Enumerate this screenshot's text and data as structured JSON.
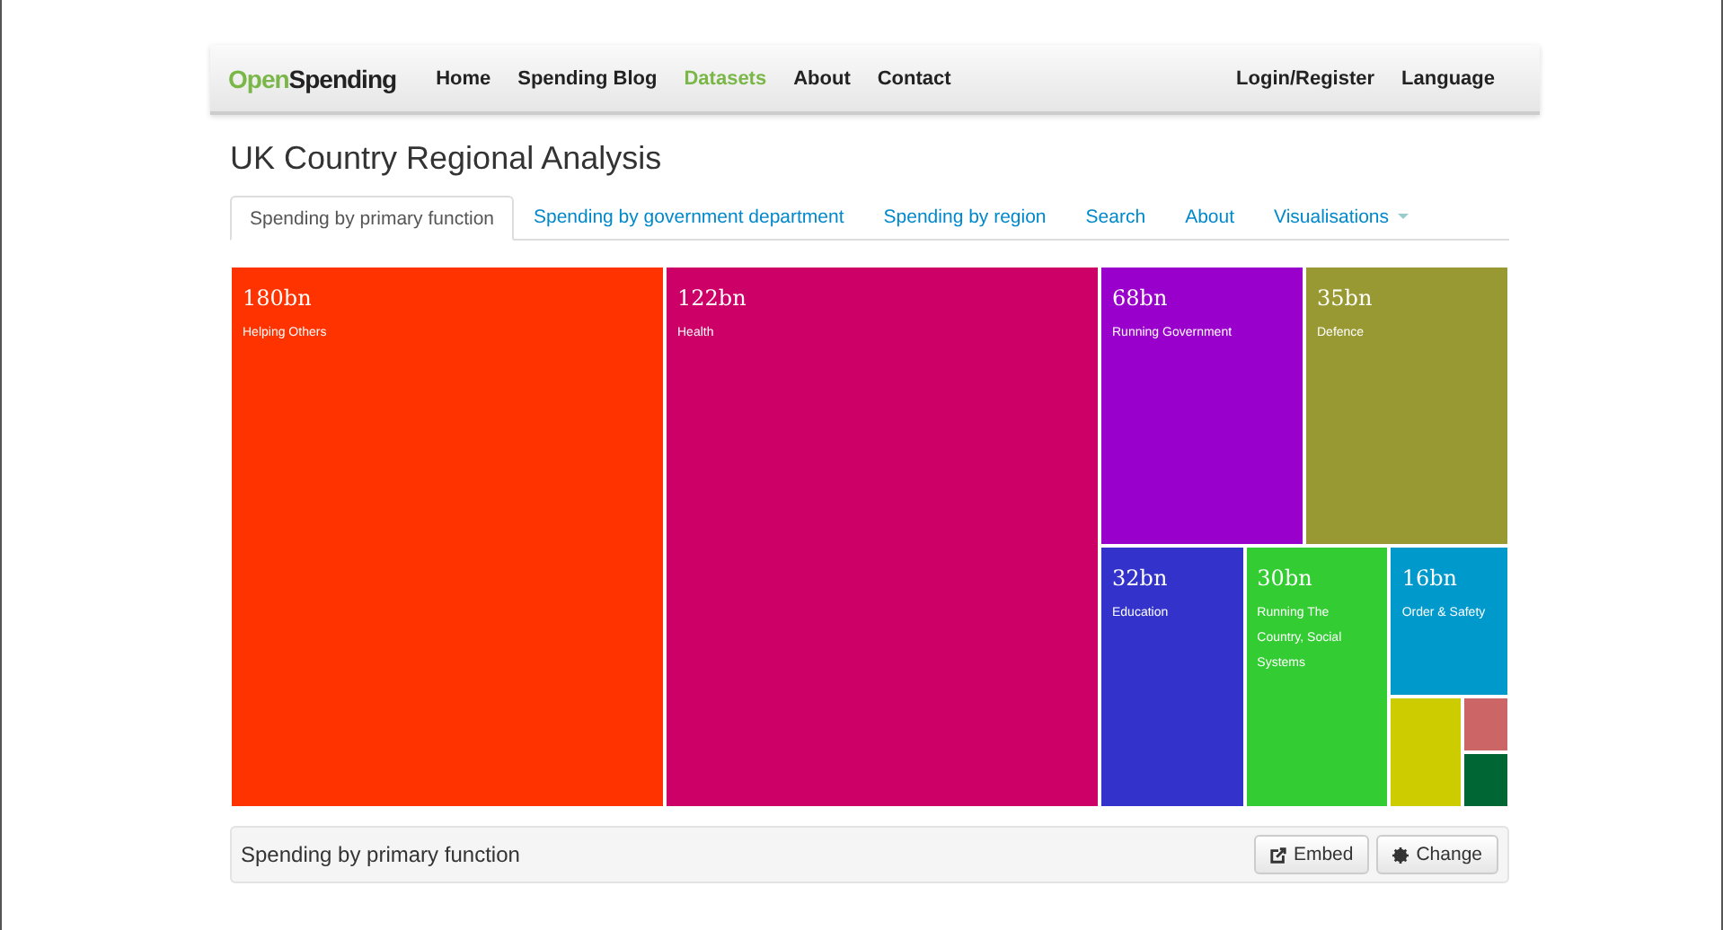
{
  "navbar": {
    "brand": {
      "first": "Open",
      "second": "Spending"
    },
    "links": [
      {
        "label": "Home",
        "selected": false
      },
      {
        "label": "Spending Blog",
        "selected": false
      },
      {
        "label": "Datasets",
        "selected": true
      },
      {
        "label": "About",
        "selected": false
      },
      {
        "label": "Contact",
        "selected": false
      }
    ],
    "right_links": [
      "Login/Register",
      "Language"
    ]
  },
  "title": "UK Country Regional Analysis",
  "tabs": [
    {
      "label": "Spending by primary function",
      "selected": true
    },
    {
      "label": "Spending by government department",
      "selected": false
    },
    {
      "label": "Spending by region",
      "selected": false
    },
    {
      "label": "Search",
      "selected": false
    },
    {
      "label": "About",
      "selected": false
    },
    {
      "label": "Visualisations",
      "selected": false,
      "dropdown": true
    }
  ],
  "treemap": {
    "tiles": [
      {
        "value": "180bn",
        "name": "Helping Others",
        "color": "#ff3300"
      },
      {
        "value": "122bn",
        "name": "Health",
        "color": "#cc0066"
      },
      {
        "value": "68bn",
        "name": "Running Government",
        "color": "#9900cc"
      },
      {
        "value": "35bn",
        "name": "Defence",
        "color": "#999933"
      },
      {
        "value": "32bn",
        "name": "Education",
        "color": "#3333cc"
      },
      {
        "value": "30bn",
        "name": "Running The Country, Social Systems",
        "color": "#33cc33"
      },
      {
        "value": "16bn",
        "name": "Order & Safety",
        "color": "#0099cc"
      },
      {
        "color": "#cccc00"
      },
      {
        "color": "#cc6666"
      },
      {
        "color": "#006633"
      }
    ]
  },
  "footer": {
    "label": "Spending by primary function",
    "buttons": [
      {
        "label": "Embed",
        "kind": "embed"
      },
      {
        "label": "Change",
        "kind": "change"
      }
    ]
  }
}
